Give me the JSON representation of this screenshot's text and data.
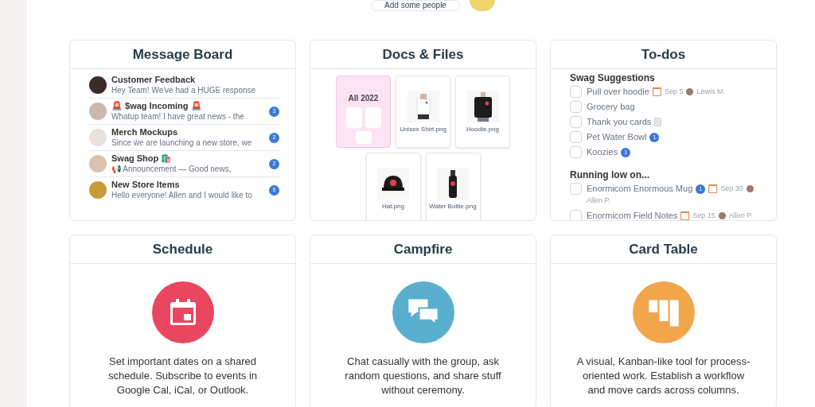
{
  "top_button": {
    "label": "Add some people"
  },
  "message_board": {
    "title": "Message Board",
    "messages": [
      {
        "title": "Customer Feedback",
        "preview": "Hey Team! We've had a HUGE response",
        "color": "#3a2a2a"
      },
      {
        "title": "🚨 $wag Incoming 🚨",
        "preview": "Whatup team! I have great news - the",
        "count": "3",
        "color": "#c9b8ae"
      },
      {
        "title": "Merch Mockups",
        "preview": "Since we are launching a new store, we",
        "count": "2",
        "color": "#e8e2dc"
      },
      {
        "title": "Swag Shop 🛍️",
        "preview": "📢 Announcement — Good news,",
        "count": "2",
        "color": "#d9c3b0"
      },
      {
        "title": "New Store Items",
        "preview": "Hello everyone! Allen and I would like to",
        "count": "5",
        "color": "#c89a3a"
      }
    ]
  },
  "docs": {
    "title": "Docs & Files",
    "folder": {
      "name": "All 2022"
    },
    "files": [
      {
        "name": "Unisex Shirt.png",
        "kind": "shirt"
      },
      {
        "name": "Hoodie.png",
        "kind": "hoodie"
      },
      {
        "name": "Hat.png",
        "kind": "hat"
      },
      {
        "name": "Water Bottle.png",
        "kind": "bottle"
      }
    ]
  },
  "todos": {
    "title": "To-dos",
    "lists": [
      {
        "name": "Swag Suggestions",
        "items": [
          {
            "text": "Pull over hoodie",
            "checked": false,
            "date": "Sep 5",
            "person": "Lewis M.",
            "note": false
          },
          {
            "text": "Grocery bag",
            "checked": false,
            "note": false
          },
          {
            "text": "Thank you cards",
            "checked": false,
            "note": true
          },
          {
            "text": "Pet Water Bowl",
            "checked": false,
            "comments": "1",
            "note": false
          },
          {
            "text": "Koozies",
            "checked": false,
            "comments": "1",
            "note": false
          }
        ]
      },
      {
        "name": "Running low on...",
        "items": [
          {
            "text": "Enormicom Enormous Mug",
            "checked": false,
            "date": "Sep 30",
            "person": "Allen P.",
            "comments": "1",
            "note": false
          },
          {
            "text": "Enormicom Field Notes",
            "checked": false,
            "date": "Sep 15",
            "person": "Allen P.",
            "note": false
          }
        ]
      }
    ]
  },
  "tools": [
    {
      "title": "Schedule",
      "kind": "calendar",
      "color": "#e8475f",
      "description": "Set important dates on a shared schedule. Subscribe to events in Google Cal, iCal, or Outlook."
    },
    {
      "title": "Campfire",
      "kind": "chat",
      "color": "#5aafcf",
      "description": "Chat casually with the group, ask random questions, and share stuff without ceremony."
    },
    {
      "title": "Card Table",
      "kind": "cards",
      "color": "#f2a64c",
      "description": "A visual, Kanban-like tool for process-oriented work. Establish a workflow and move cards across columns."
    }
  ]
}
